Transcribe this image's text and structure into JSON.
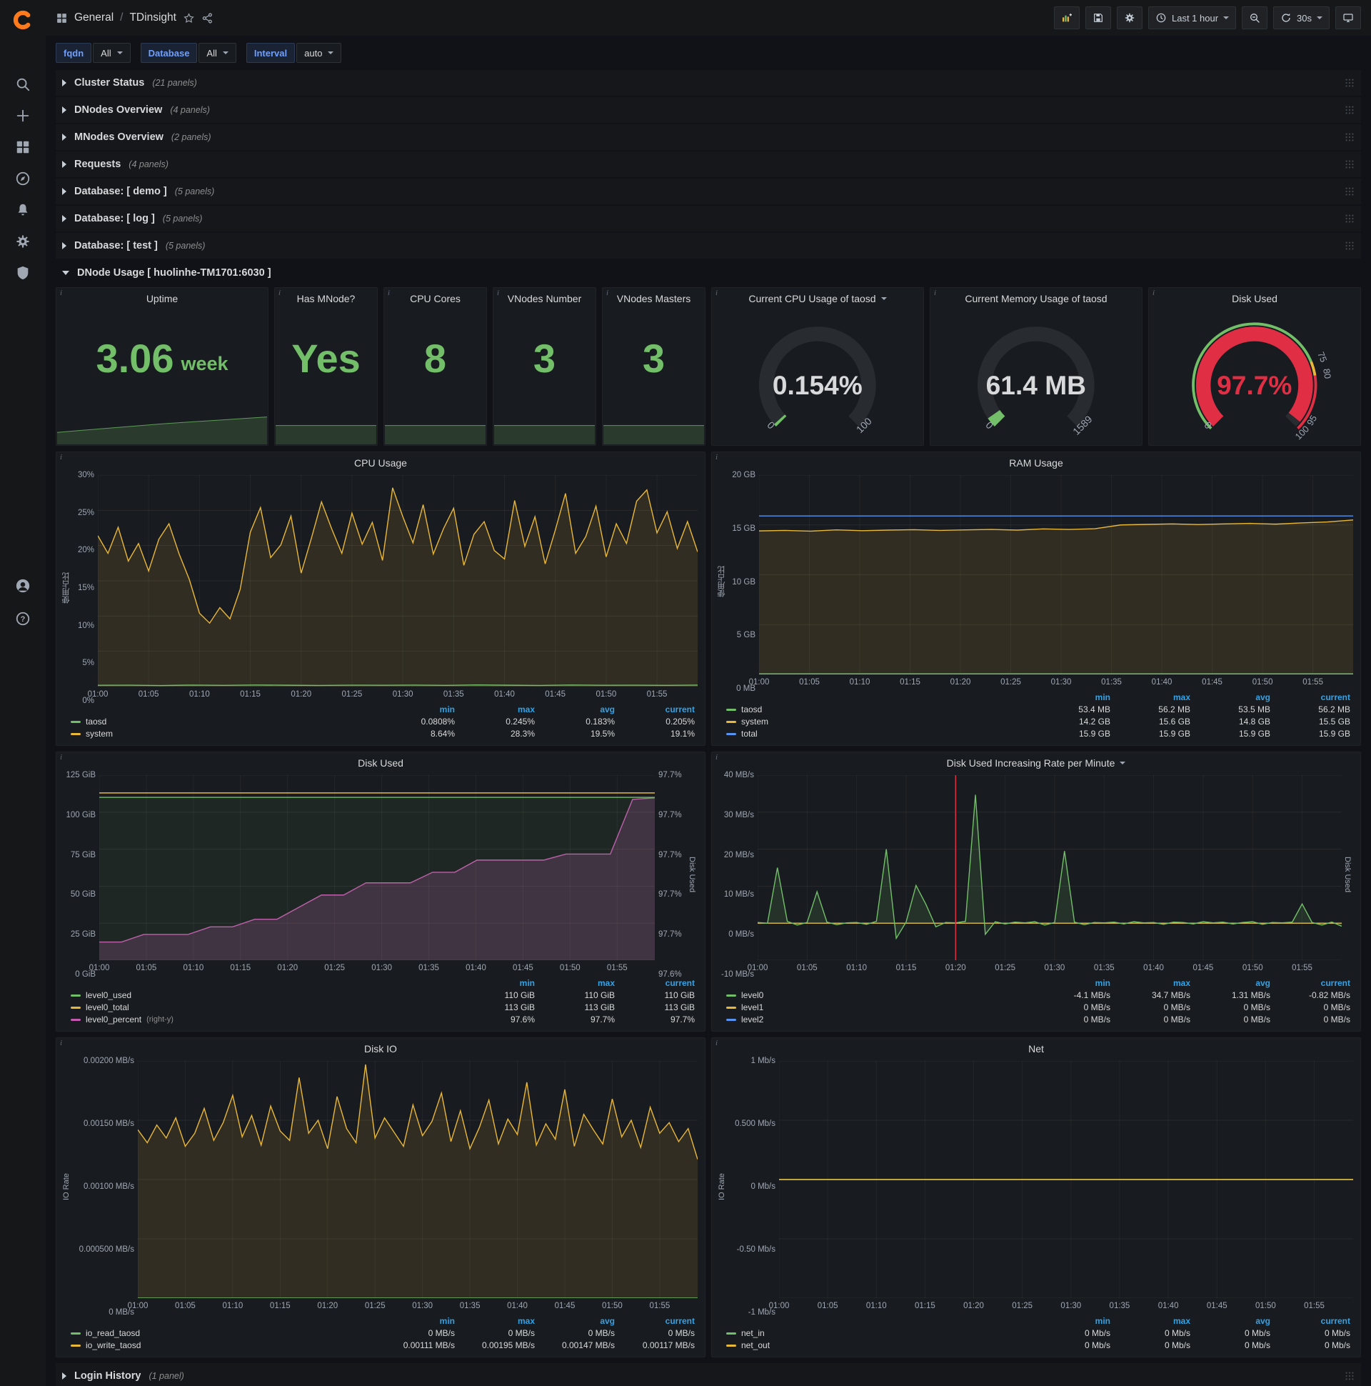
{
  "navbar": {
    "breadcrumb": {
      "section": "General",
      "separator": "/",
      "title": "TDinsight"
    },
    "time_picker_label": "Last 1 hour",
    "refresh_interval": "30s"
  },
  "variables": [
    {
      "label": "fqdn",
      "value": "All"
    },
    {
      "label": "Database",
      "value": "All"
    },
    {
      "label": "Interval",
      "value": "auto"
    }
  ],
  "collapsed_rows": [
    {
      "title": "Cluster Status",
      "count": "(21 panels)"
    },
    {
      "title": "DNodes Overview",
      "count": "(4 panels)"
    },
    {
      "title": "MNodes Overview",
      "count": "(2 panels)"
    },
    {
      "title": "Requests",
      "count": "(4 panels)"
    },
    {
      "title": "Database: [ demo ]",
      "count": "(5 panels)"
    },
    {
      "title": "Database: [ log ]",
      "count": "(5 panels)"
    },
    {
      "title": "Database: [ test ]",
      "count": "(5 panels)"
    }
  ],
  "expanded_row": {
    "title": "DNode Usage [ huolinhe-TM1701:6030 ]"
  },
  "bottom_row": {
    "title": "Login History",
    "count": "(1 panel)"
  },
  "stat_panels": [
    {
      "title": "Uptime",
      "value": "3.06",
      "unit": "week",
      "spark": [
        0.35,
        0.4,
        0.45,
        0.5,
        0.55,
        0.6,
        0.64,
        0.68,
        0.72,
        0.76,
        0.8
      ]
    },
    {
      "title": "Has MNode?",
      "value": "Yes",
      "unit": "",
      "spark": [
        0.55,
        0.55
      ]
    },
    {
      "title": "CPU Cores",
      "value": "8",
      "unit": "",
      "spark": [
        0.55,
        0.55
      ]
    },
    {
      "title": "VNodes Number",
      "value": "3",
      "unit": "",
      "spark": [
        0.55,
        0.55
      ]
    },
    {
      "title": "VNodes Masters",
      "value": "3",
      "unit": "",
      "spark": [
        0.55,
        0.55
      ]
    }
  ],
  "gauge_panels": [
    {
      "title": "Current CPU Usage of taosd",
      "has_dropdown": true,
      "value": "0.154%",
      "percent": 0.154,
      "min_label": "0",
      "max_label": "100",
      "value_color": "#d8d9da",
      "arc_color": "#73bf69"
    },
    {
      "title": "Current Memory Usage of taosd",
      "value": "61.4 MB",
      "percent": 3.86,
      "min_label": "0",
      "max_label": "1589",
      "value_color": "#d8d9da",
      "arc_color": "#73bf69"
    },
    {
      "title": "Disk Used",
      "value": "97.7%",
      "percent": 97.7,
      "min_label": "0",
      "max_label": "",
      "value_color": "#e02f44",
      "arc_color": "#e02f44",
      "ring": [
        {
          "from": 0,
          "to": 75,
          "color": "#73bf69"
        },
        {
          "from": 75,
          "to": 80,
          "color": "#eab839"
        },
        {
          "from": 80,
          "to": 100,
          "color": "#e02f44"
        }
      ],
      "thresholds": [
        {
          "label": "75",
          "pct": 75
        },
        {
          "label": "80",
          "pct": 80
        },
        {
          "label": "95",
          "pct": 95
        },
        {
          "label": "100",
          "pct": 100
        }
      ]
    }
  ],
  "chart_data": {
    "cpu_usage": {
      "type": "line",
      "title": "CPU Usage",
      "ylabel": "使用占比",
      "ymin": 0,
      "ymax": 30,
      "yticks": [
        "30%",
        "25%",
        "20%",
        "15%",
        "10%",
        "5%",
        "0%"
      ],
      "xticks": [
        "01:00",
        "01:05",
        "01:10",
        "01:15",
        "01:20",
        "01:25",
        "01:30",
        "01:35",
        "01:40",
        "01:45",
        "01:50",
        "01:55"
      ],
      "series": [
        {
          "name": "system",
          "color": "#eab839",
          "fill": 0.12,
          "values": [
            21.4,
            18.9,
            22.6,
            17.8,
            20.3,
            16.4,
            20.9,
            23.1,
            18.8,
            15.2,
            10.4,
            9.0,
            11.2,
            9.6,
            13.8,
            21.9,
            25.4,
            18.3,
            20.1,
            24.2,
            16.1,
            21.0,
            26.2,
            22.4,
            18.9,
            24.6,
            20.2,
            23.3,
            17.9,
            28.2,
            24.1,
            20.4,
            25.8,
            18.8,
            22.4,
            25.3,
            17.2,
            21.6,
            23.4,
            19.3,
            18.1,
            26.4,
            19.9,
            24.1,
            17.4,
            22.2,
            27.4,
            18.9,
            21.3,
            25.6,
            18.4,
            23.1,
            20.3,
            26.3,
            27.9,
            21.8,
            24.8,
            19.6,
            23.4,
            19.1
          ]
        },
        {
          "name": "taosd",
          "color": "#73bf69",
          "fill": 0.1,
          "values": [
            0.18,
            0.2,
            0.15,
            0.21,
            0.17,
            0.22,
            0.19,
            0.16,
            0.2,
            0.18,
            0.21,
            0.17,
            0.23,
            0.19,
            0.16,
            0.22,
            0.18,
            0.2,
            0.17,
            0.21
          ]
        }
      ],
      "legend": {
        "cols": [
          "min",
          "max",
          "avg",
          "current"
        ],
        "rows": [
          {
            "name": "taosd",
            "color": "#73bf69",
            "values": [
              "0.0808%",
              "0.245%",
              "0.183%",
              "0.205%"
            ]
          },
          {
            "name": "system",
            "color": "#eab839",
            "values": [
              "8.64%",
              "28.3%",
              "19.5%",
              "19.1%"
            ]
          }
        ]
      }
    },
    "ram_usage": {
      "type": "line",
      "title": "RAM Usage",
      "ylabel": "使用占比",
      "ymin": 0,
      "ymax": 20,
      "yticks": [
        "20 GB",
        "15 GB",
        "10 GB",
        "5 GB",
        "0 MB"
      ],
      "xticks": [
        "01:00",
        "01:05",
        "01:10",
        "01:15",
        "01:20",
        "01:25",
        "01:30",
        "01:35",
        "01:40",
        "01:45",
        "01:50",
        "01:55"
      ],
      "series": [
        {
          "name": "system",
          "color": "#eab839",
          "fill": 0.12,
          "values": [
            14.4,
            14.45,
            14.38,
            14.5,
            14.42,
            14.48,
            14.52,
            14.45,
            14.5,
            14.55,
            14.48,
            14.6,
            14.55,
            14.62,
            15.0,
            15.05,
            15.1,
            15.04,
            15.1,
            15.15,
            15.08,
            15.2,
            15.3,
            15.5
          ]
        },
        {
          "name": "total",
          "color": "#5794f2",
          "fill": 0,
          "values": [
            15.9,
            15.9,
            15.9,
            15.9,
            15.9,
            15.9,
            15.9,
            15.9,
            15.9,
            15.9,
            15.9,
            15.9
          ]
        },
        {
          "name": "taosd",
          "color": "#73bf69",
          "fill": 0.1,
          "values": [
            0.052,
            0.052,
            0.052,
            0.052,
            0.052,
            0.052
          ]
        }
      ],
      "legend": {
        "cols": [
          "min",
          "max",
          "avg",
          "current"
        ],
        "rows": [
          {
            "name": "taosd",
            "color": "#73bf69",
            "values": [
              "53.4 MB",
              "56.2 MB",
              "53.5 MB",
              "56.2 MB"
            ]
          },
          {
            "name": "system",
            "color": "#eab839",
            "values": [
              "14.2 GB",
              "15.6 GB",
              "14.8 GB",
              "15.5 GB"
            ]
          },
          {
            "name": "total",
            "color": "#5794f2",
            "values": [
              "15.9 GB",
              "15.9 GB",
              "15.9 GB",
              "15.9 GB"
            ]
          }
        ]
      }
    },
    "disk_used": {
      "type": "line",
      "title": "Disk Used",
      "ymin": 0,
      "ymax": 125,
      "yticks": [
        "125 GiB",
        "100 GiB",
        "75 GiB",
        "50 GiB",
        "25 GiB",
        "0 GiB"
      ],
      "right_ymin": 97.594,
      "right_ymax": 97.716,
      "right_yticks": [
        "97.7%",
        "97.7%",
        "97.7%",
        "97.7%",
        "97.7%",
        "97.6%"
      ],
      "right_label": "Disk Used",
      "xticks": [
        "01:00",
        "01:05",
        "01:10",
        "01:15",
        "01:20",
        "01:25",
        "01:30",
        "01:35",
        "01:40",
        "01:45",
        "01:50",
        "01:55"
      ],
      "series": [
        {
          "name": "level0_percent",
          "axis": "right",
          "color": "#c45ab0",
          "fill": 0.22,
          "values": [
            97.606,
            97.606,
            97.611,
            97.611,
            97.611,
            97.616,
            97.616,
            97.621,
            97.621,
            97.629,
            97.637,
            97.637,
            97.645,
            97.645,
            97.645,
            97.652,
            97.652,
            97.66,
            97.66,
            97.66,
            97.66,
            97.664,
            97.664,
            97.664,
            97.7,
            97.701
          ]
        },
        {
          "name": "level0_used",
          "color": "#73bf69",
          "fill": 0.08,
          "values": [
            110,
            110
          ]
        },
        {
          "name": "level0_total",
          "color": "#eab839",
          "fill": 0,
          "values": [
            113,
            113
          ]
        }
      ],
      "legend": {
        "cols": [
          "min",
          "max",
          "current"
        ],
        "rows": [
          {
            "name": "level0_used",
            "color": "#73bf69",
            "values": [
              "110 GiB",
              "110 GiB",
              "110 GiB"
            ]
          },
          {
            "name": "level0_total",
            "color": "#eab839",
            "values": [
              "113 GiB",
              "113 GiB",
              "113 GiB"
            ]
          },
          {
            "name": "level0_percent",
            "suffix": "(right-y)",
            "color": "#c45ab0",
            "values": [
              "97.6%",
              "97.7%",
              "97.7%"
            ]
          }
        ]
      }
    },
    "disk_rate": {
      "type": "line",
      "title": "Disk Used Increasing Rate per Minute",
      "has_dropdown": true,
      "ymin": -10,
      "ymax": 40,
      "yticks": [
        "40 MB/s",
        "30 MB/s",
        "20 MB/s",
        "10 MB/s",
        "0 MB/s",
        "-10 MB/s"
      ],
      "right_label": "Disk Used",
      "annotation_x": 0.339,
      "xticks": [
        "01:00",
        "01:05",
        "01:10",
        "01:15",
        "01:20",
        "01:25",
        "01:30",
        "01:35",
        "01:40",
        "01:45",
        "01:50",
        "01:55"
      ],
      "series": [
        {
          "name": "level2",
          "color": "#5794f2",
          "fill": 0,
          "values": [
            0,
            0
          ]
        },
        {
          "name": "level1",
          "color": "#eab839",
          "fill": 0,
          "values": [
            0,
            0
          ]
        },
        {
          "name": "level0",
          "color": "#73bf69",
          "fill": 0.15,
          "values": [
            0.2,
            0.0,
            15.0,
            0.5,
            -0.5,
            0.2,
            8.5,
            0.3,
            -0.4,
            0.1,
            0.2,
            -0.3,
            0.5,
            20.0,
            -4.1,
            0.3,
            10.2,
            5.1,
            -1.0,
            0.2,
            0.1,
            0.5,
            34.7,
            -3.0,
            0.4,
            -0.2,
            0.3,
            0.1,
            0.4,
            -0.5,
            0.2,
            19.5,
            0.3,
            -0.4,
            0.2,
            0.1,
            0.3,
            -0.2,
            0.4,
            0.1,
            0.2,
            -0.3,
            0.3,
            0.2,
            -0.2,
            0.4,
            0.1,
            0.3,
            -0.2,
            0.2,
            0.4,
            -0.3,
            0.2,
            0.1,
            0.3,
            5.2,
            0.2,
            -0.5,
            0.3,
            -0.82
          ]
        }
      ],
      "legend": {
        "cols": [
          "min",
          "max",
          "avg",
          "current"
        ],
        "rows": [
          {
            "name": "level0",
            "color": "#73bf69",
            "values": [
              "-4.1 MB/s",
              "34.7 MB/s",
              "1.31 MB/s",
              "-0.82 MB/s"
            ]
          },
          {
            "name": "level1",
            "color": "#eab839",
            "values": [
              "0 MB/s",
              "0 MB/s",
              "0 MB/s",
              "0 MB/s"
            ]
          },
          {
            "name": "level2",
            "color": "#5794f2",
            "values": [
              "0 MB/s",
              "0 MB/s",
              "0 MB/s",
              "0 MB/s"
            ]
          }
        ]
      }
    },
    "disk_io": {
      "type": "line",
      "title": "Disk IO",
      "ylabel": "IO Rate",
      "ymin": 0,
      "ymax": 0.002,
      "yticks": [
        "0.00200 MB/s",
        "0.00150 MB/s",
        "0.00100 MB/s",
        "0.000500 MB/s",
        "0 MB/s"
      ],
      "xticks": [
        "01:00",
        "01:05",
        "01:10",
        "01:15",
        "01:20",
        "01:25",
        "01:30",
        "01:35",
        "01:40",
        "01:45",
        "01:50",
        "01:55"
      ],
      "series": [
        {
          "name": "io_write_taosd",
          "color": "#eab839",
          "fill": 0.12,
          "values": [
            0.00142,
            0.00131,
            0.00146,
            0.00135,
            0.00152,
            0.00128,
            0.00139,
            0.0016,
            0.00133,
            0.00148,
            0.00171,
            0.00136,
            0.00154,
            0.00129,
            0.00162,
            0.00141,
            0.00133,
            0.00186,
            0.00139,
            0.0015,
            0.00126,
            0.0017,
            0.00143,
            0.00131,
            0.00197,
            0.00135,
            0.00152,
            0.0014,
            0.00128,
            0.00163,
            0.00137,
            0.00149,
            0.00173,
            0.00132,
            0.00158,
            0.00126,
            0.00144,
            0.00167,
            0.0013,
            0.00151,
            0.00138,
            0.00182,
            0.00129,
            0.00147,
            0.00134,
            0.00176,
            0.00128,
            0.00155,
            0.00142,
            0.0013,
            0.00168,
            0.00136,
            0.0015,
            0.00127,
            0.00161,
            0.00139,
            0.00148,
            0.00132,
            0.00143,
            0.00117
          ]
        },
        {
          "name": "io_read_taosd",
          "color": "#73bf69",
          "fill": 0,
          "values": [
            0,
            0
          ]
        }
      ],
      "legend": {
        "cols": [
          "min",
          "max",
          "avg",
          "current"
        ],
        "rows": [
          {
            "name": "io_read_taosd",
            "color": "#73bf69",
            "values": [
              "0 MB/s",
              "0 MB/s",
              "0 MB/s",
              "0 MB/s"
            ]
          },
          {
            "name": "io_write_taosd",
            "color": "#eab839",
            "values": [
              "0.00111 MB/s",
              "0.00195 MB/s",
              "0.00147 MB/s",
              "0.00117 MB/s"
            ]
          }
        ]
      }
    },
    "net": {
      "type": "line",
      "title": "Net",
      "ylabel": "IO Rate",
      "ymin": -1,
      "ymax": 1,
      "yticks": [
        "1 Mb/s",
        "0.500 Mb/s",
        "0 Mb/s",
        "-0.50 Mb/s",
        "-1 Mb/s"
      ],
      "xticks": [
        "01:00",
        "01:05",
        "01:10",
        "01:15",
        "01:20",
        "01:25",
        "01:30",
        "01:35",
        "01:40",
        "01:45",
        "01:50",
        "01:55"
      ],
      "series": [
        {
          "name": "net_in",
          "color": "#73bf69",
          "fill": 0,
          "values": [
            0,
            0
          ]
        },
        {
          "name": "net_out",
          "color": "#eab839",
          "fill": 0,
          "values": [
            0,
            0
          ]
        }
      ],
      "legend": {
        "cols": [
          "min",
          "max",
          "avg",
          "current"
        ],
        "rows": [
          {
            "name": "net_in",
            "color": "#73bf69",
            "values": [
              "0 Mb/s",
              "0 Mb/s",
              "0 Mb/s",
              "0 Mb/s"
            ]
          },
          {
            "name": "net_out",
            "color": "#eab839",
            "values": [
              "0 Mb/s",
              "0 Mb/s",
              "0 Mb/s",
              "0 Mb/s"
            ]
          }
        ]
      }
    }
  },
  "colors": {
    "green": "#73bf69",
    "yellow": "#eab839",
    "blue": "#5794f2",
    "pink": "#c45ab0",
    "red": "#e02f44",
    "legend_header_blue": "#33a2e5",
    "panel_bg": "#181b1f",
    "page_bg": "#111217",
    "brand_orange": "#ff7a1a"
  },
  "icons": [
    "grafana-logo",
    "search-icon",
    "add-icon",
    "dashboards-icon",
    "explore-compass-icon",
    "alerting-bell-icon",
    "configuration-gear-icon",
    "server-admin-shield-icon",
    "user-avatar",
    "help-icon",
    "add-panel-icon",
    "save-dashboard-icon",
    "dashboard-settings-gear-icon",
    "clock-icon",
    "zoom-out-icon",
    "refresh-icon",
    "cycle-view-monitor-icon",
    "star-icon",
    "share-icon",
    "drag-handle-icon",
    "panel-info-icon",
    "chevron-down-icon",
    "chevron-right-icon"
  ]
}
